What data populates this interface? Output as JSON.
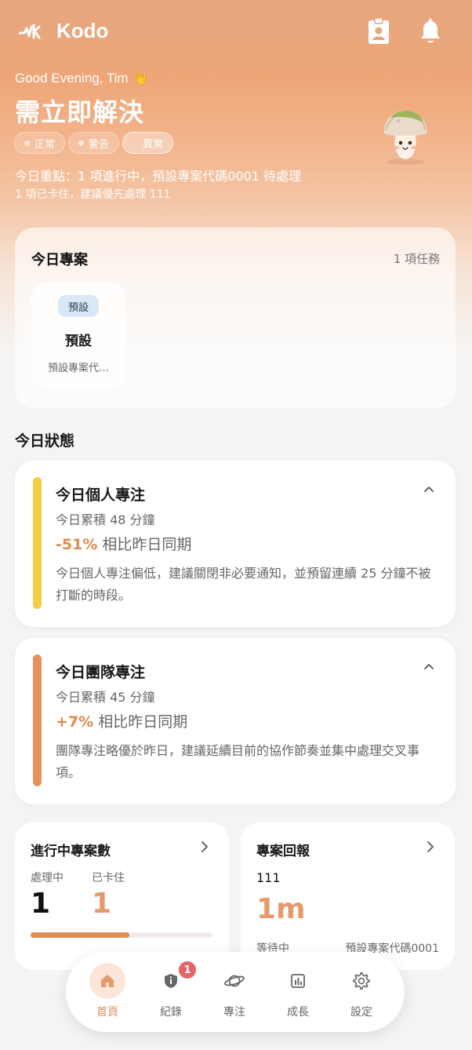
{
  "app": {
    "name": "Kodo"
  },
  "header": {
    "greeting": "Good Evening, Tim 👋",
    "headline": "需立即解決",
    "chips": [
      {
        "label": "正常",
        "active": false
      },
      {
        "label": "警告",
        "active": false
      },
      {
        "label": "異常",
        "active": true
      }
    ],
    "summary_line1": "今日重點：1 項進行中，預設專案代碼0001 待處理",
    "summary_line2": "1 項已卡住，建議優先處理 111"
  },
  "projects": {
    "title": "今日專案",
    "meta": "1 項任務",
    "items": [
      {
        "tag": "預設",
        "name": "預設",
        "code": "預設專案代…"
      }
    ]
  },
  "status_section": {
    "title": "今日狀態"
  },
  "focus_cards": [
    {
      "title": "今日個人專注",
      "total": "今日累積 48 分鐘",
      "change": "-51%",
      "change_suffix": "相比昨日同期",
      "advice": "今日個人專注偏低，建議關閉非必要通知，並預留連續 25 分鐘不被打斷的時段。",
      "accent_color": "#f3cd45"
    },
    {
      "title": "今日團隊專注",
      "total": "今日累積 45 分鐘",
      "change": "+7%",
      "change_suffix": "相比昨日同期",
      "advice": "團隊專注略優於昨日，建議延續目前的協作節奏並集中處理交叉事項。",
      "accent_color": "#e5915e"
    }
  ],
  "active_projects": {
    "title": "進行中專案數",
    "in_progress_label": "處理中",
    "in_progress_value": "1",
    "stuck_label": "已卡住",
    "stuck_value": "1",
    "progress_fraction": 0.543
  },
  "report": {
    "title": "專案回報",
    "id": "111",
    "elapsed": "1m",
    "status": "等待中",
    "code": "預設專案代碼0001"
  },
  "tabbar": {
    "items": [
      {
        "label": "首頁",
        "icon": "home-icon",
        "active": true
      },
      {
        "label": "紀錄",
        "icon": "shield-info-icon",
        "badge": "1"
      },
      {
        "label": "專注",
        "icon": "planet-icon"
      },
      {
        "label": "成長",
        "icon": "chart-icon"
      },
      {
        "label": "設定",
        "icon": "gear-icon"
      }
    ]
  },
  "colors": {
    "accent": "#e08e5b",
    "badge": "#e2656a",
    "tag_bg": "#d9e8f6"
  }
}
